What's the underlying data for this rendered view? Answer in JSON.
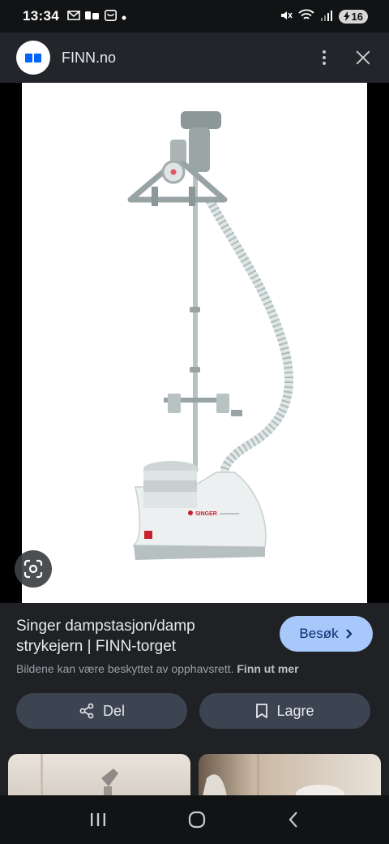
{
  "status_bar": {
    "time": "13:34",
    "battery": "16",
    "left_icons": [
      "gmail-icon",
      "message-icon",
      "shop-icon",
      "dot-icon"
    ],
    "right_icons": [
      "mute-icon",
      "wifi-icon",
      "signal-icon",
      "battery-icon"
    ]
  },
  "header": {
    "site_name": "FINN.no",
    "logo_color": "#0063fb"
  },
  "image": {
    "product": "steamer",
    "brand_on_product": "SINGER"
  },
  "result": {
    "title": "Singer dampstasjon/damp strykejern | FINN-torget",
    "visit_label": "Besøk",
    "copyright_text": "Bildene kan være beskyttet av opphavsrett.",
    "learn_more": "Finn ut mer"
  },
  "actions": {
    "share_label": "Del",
    "save_label": "Lagre"
  },
  "colors": {
    "accent": "#a8c7fa",
    "panel": "#1f2124",
    "button": "#3c4452"
  }
}
